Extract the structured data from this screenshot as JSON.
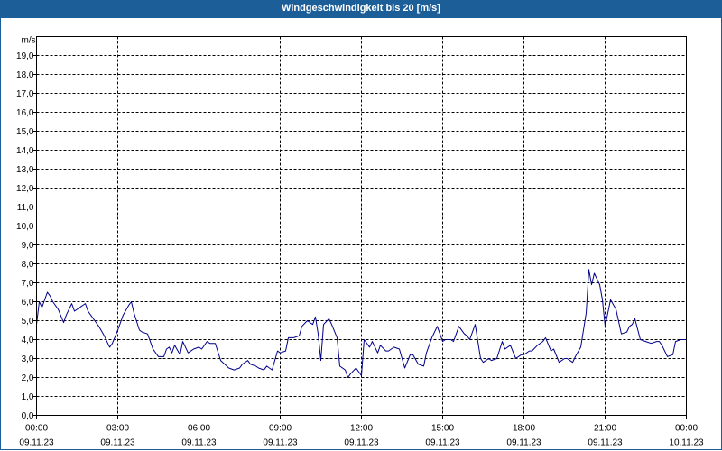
{
  "title": "Windgeschwindigkeit bis 20 [m/s]",
  "chart_data": {
    "type": "line",
    "title": "Windgeschwindigkeit bis 20 [m/s]",
    "ylabel": "m/s",
    "ylim": [
      0,
      20
    ],
    "yticks": [
      "0,0",
      "1,0",
      "2,0",
      "3,0",
      "4,0",
      "5,0",
      "6,0",
      "7,0",
      "8,0",
      "9,0",
      "10,0",
      "11,0",
      "12,0",
      "13,0",
      "14,0",
      "15,0",
      "16,0",
      "17,0",
      "18,0",
      "19,0"
    ],
    "xlim": [
      0,
      24
    ],
    "xticks": [
      {
        "time": "00:00",
        "date": "09.11.23"
      },
      {
        "time": "03:00",
        "date": "09.11.23"
      },
      {
        "time": "06:00",
        "date": "09.11.23"
      },
      {
        "time": "09:00",
        "date": "09.11.23"
      },
      {
        "time": "12:00",
        "date": "09.11.23"
      },
      {
        "time": "15:00",
        "date": "09.11.23"
      },
      {
        "time": "18:00",
        "date": "09.11.23"
      },
      {
        "time": "21:00",
        "date": "09.11.23"
      },
      {
        "time": "00:00",
        "date": "10.11.23"
      }
    ],
    "grid": true,
    "line_color": "#00008b",
    "series": [
      {
        "x": [
          0,
          0.1,
          0.2,
          0.4,
          0.5,
          0.6,
          0.8,
          1.0,
          1.1,
          1.3,
          1.4,
          1.6,
          1.8,
          1.9,
          2.1,
          2.3,
          2.5,
          2.7,
          2.8,
          3.0,
          3.2,
          3.4,
          3.5,
          3.6,
          3.8,
          3.9,
          4.1,
          4.3,
          4.5,
          4.7,
          4.8,
          4.9,
          5.0,
          5.1,
          5.3,
          5.4,
          5.6,
          5.8,
          6.0,
          6.1,
          6.3,
          6.4,
          6.6,
          6.8,
          7.1,
          7.3,
          7.5,
          7.6,
          7.8,
          7.9,
          8.1,
          8.2,
          8.4,
          8.5,
          8.7,
          8.9,
          9.0,
          9.2,
          9.3,
          9.5,
          9.7,
          9.8,
          10.0,
          10.2,
          10.3,
          10.4,
          10.5,
          10.6,
          10.8,
          10.9,
          11.1,
          11.2,
          11.4,
          11.5,
          11.6,
          11.8,
          12.0,
          12.1,
          12.3,
          12.4,
          12.6,
          12.7,
          12.9,
          13.0,
          13.2,
          13.4,
          13.6,
          13.8,
          13.9,
          14.1,
          14.3,
          14.4,
          14.6,
          14.8,
          15.0,
          15.1,
          15.3,
          15.4,
          15.6,
          15.8,
          15.9,
          16.0,
          16.2,
          16.4,
          16.5,
          16.7,
          16.8,
          17.0,
          17.2,
          17.3,
          17.5,
          17.7,
          17.9,
          18.0,
          18.2,
          18.3,
          18.5,
          18.7,
          18.8,
          19.0,
          19.1,
          19.3,
          19.5,
          19.6,
          19.8,
          19.9,
          20.1,
          20.3,
          20.4,
          20.5,
          20.6,
          20.8,
          20.9,
          21.0,
          21.2,
          21.4,
          21.6,
          21.8,
          21.9,
          22.0,
          22.1,
          22.3,
          22.5,
          22.7,
          22.9,
          23.0,
          23.1,
          23.3,
          23.5,
          23.6,
          23.8,
          24.0
        ],
        "y": [
          4.8,
          6.0,
          5.7,
          6.5,
          6.3,
          6.0,
          5.6,
          4.9,
          5.3,
          5.9,
          5.5,
          5.7,
          5.9,
          5.5,
          5.1,
          4.7,
          4.2,
          3.6,
          3.8,
          4.5,
          5.3,
          5.8,
          6.0,
          5.4,
          4.5,
          4.4,
          4.3,
          3.5,
          3.1,
          3.1,
          3.5,
          3.6,
          3.3,
          3.7,
          3.2,
          3.9,
          3.3,
          3.5,
          3.6,
          3.5,
          3.9,
          3.8,
          3.8,
          2.9,
          2.5,
          2.4,
          2.5,
          2.7,
          2.9,
          2.7,
          2.6,
          2.5,
          2.4,
          2.6,
          2.4,
          3.4,
          3.3,
          3.4,
          4.1,
          4.1,
          4.2,
          4.7,
          5.0,
          4.8,
          5.2,
          4.3,
          2.9,
          4.8,
          5.1,
          4.8,
          4.1,
          2.6,
          2.4,
          2.0,
          2.2,
          2.5,
          2.1,
          4.0,
          3.6,
          3.9,
          3.3,
          3.7,
          3.4,
          3.4,
          3.6,
          3.5,
          2.5,
          3.2,
          3.2,
          2.7,
          2.6,
          3.3,
          4.1,
          4.7,
          3.9,
          4.0,
          4.0,
          3.9,
          4.7,
          4.3,
          4.2,
          4.0,
          4.8,
          3.0,
          2.8,
          3.0,
          2.9,
          3.0,
          3.9,
          3.5,
          3.7,
          3.0,
          3.2,
          3.2,
          3.4,
          3.4,
          3.7,
          3.9,
          4.1,
          3.4,
          3.5,
          2.8,
          3.0,
          3.0,
          2.8,
          3.1,
          3.6,
          5.4,
          7.7,
          6.9,
          7.5,
          6.9,
          6.1,
          4.7,
          6.1,
          5.6,
          4.3,
          4.4,
          4.7,
          4.8,
          5.1,
          4.0,
          3.9,
          3.8,
          3.9,
          3.9,
          3.7,
          3.1,
          3.2,
          3.9,
          4.0,
          4.0
        ]
      }
    ]
  }
}
